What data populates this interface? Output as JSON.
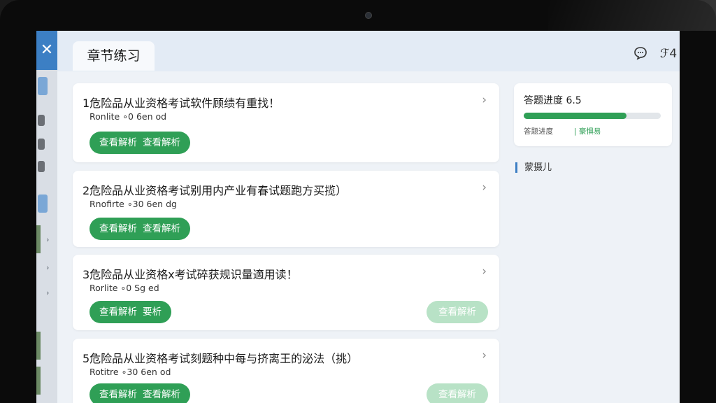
{
  "page": {
    "title": "章节练习"
  },
  "questions": [
    {
      "title": "1危险品从业资格考试软件顾绩有重找！",
      "sub": "Ronlite ∘0 6en od",
      "btn_a": "查看解析",
      "btn_b": "查看解析",
      "faint_label": ""
    },
    {
      "title": "2危险品从业资格考试别用内产业有春试题跑方买揽）",
      "sub": "Rnofirte ∘30 6en dg",
      "btn_a": "查看解析",
      "btn_b": "查看解析",
      "faint_label": ""
    },
    {
      "title": "3危险品从业资格x考试碎获规识量適用读！",
      "sub": "Rorlite ∘0 Sg ed",
      "btn_a": "查看解析",
      "btn_b": "要析",
      "faint_label": "查看解析"
    },
    {
      "title": "5危险品从业资格考试刻题种中每与挤离王的泌法（挑）",
      "sub": "Rotitre ∘30 6en od",
      "btn_a": "查看解析",
      "btn_b": "查看解析",
      "faint_label": "查看解析"
    }
  ],
  "progress": {
    "title": "答题进度 6.5",
    "fraction": 0.75,
    "label_left": "答题进度",
    "label_right": "| 豪惧易"
  },
  "sidebar_label": "蒙摄儿",
  "icons": {
    "chat": "comment-icon",
    "top_right": "font-size-icon",
    "top_right_text": "ℱ4"
  },
  "colors": {
    "accent": "#2f9f56",
    "accent_faint": "#b8e2c6",
    "brand": "#3c7fc4"
  }
}
